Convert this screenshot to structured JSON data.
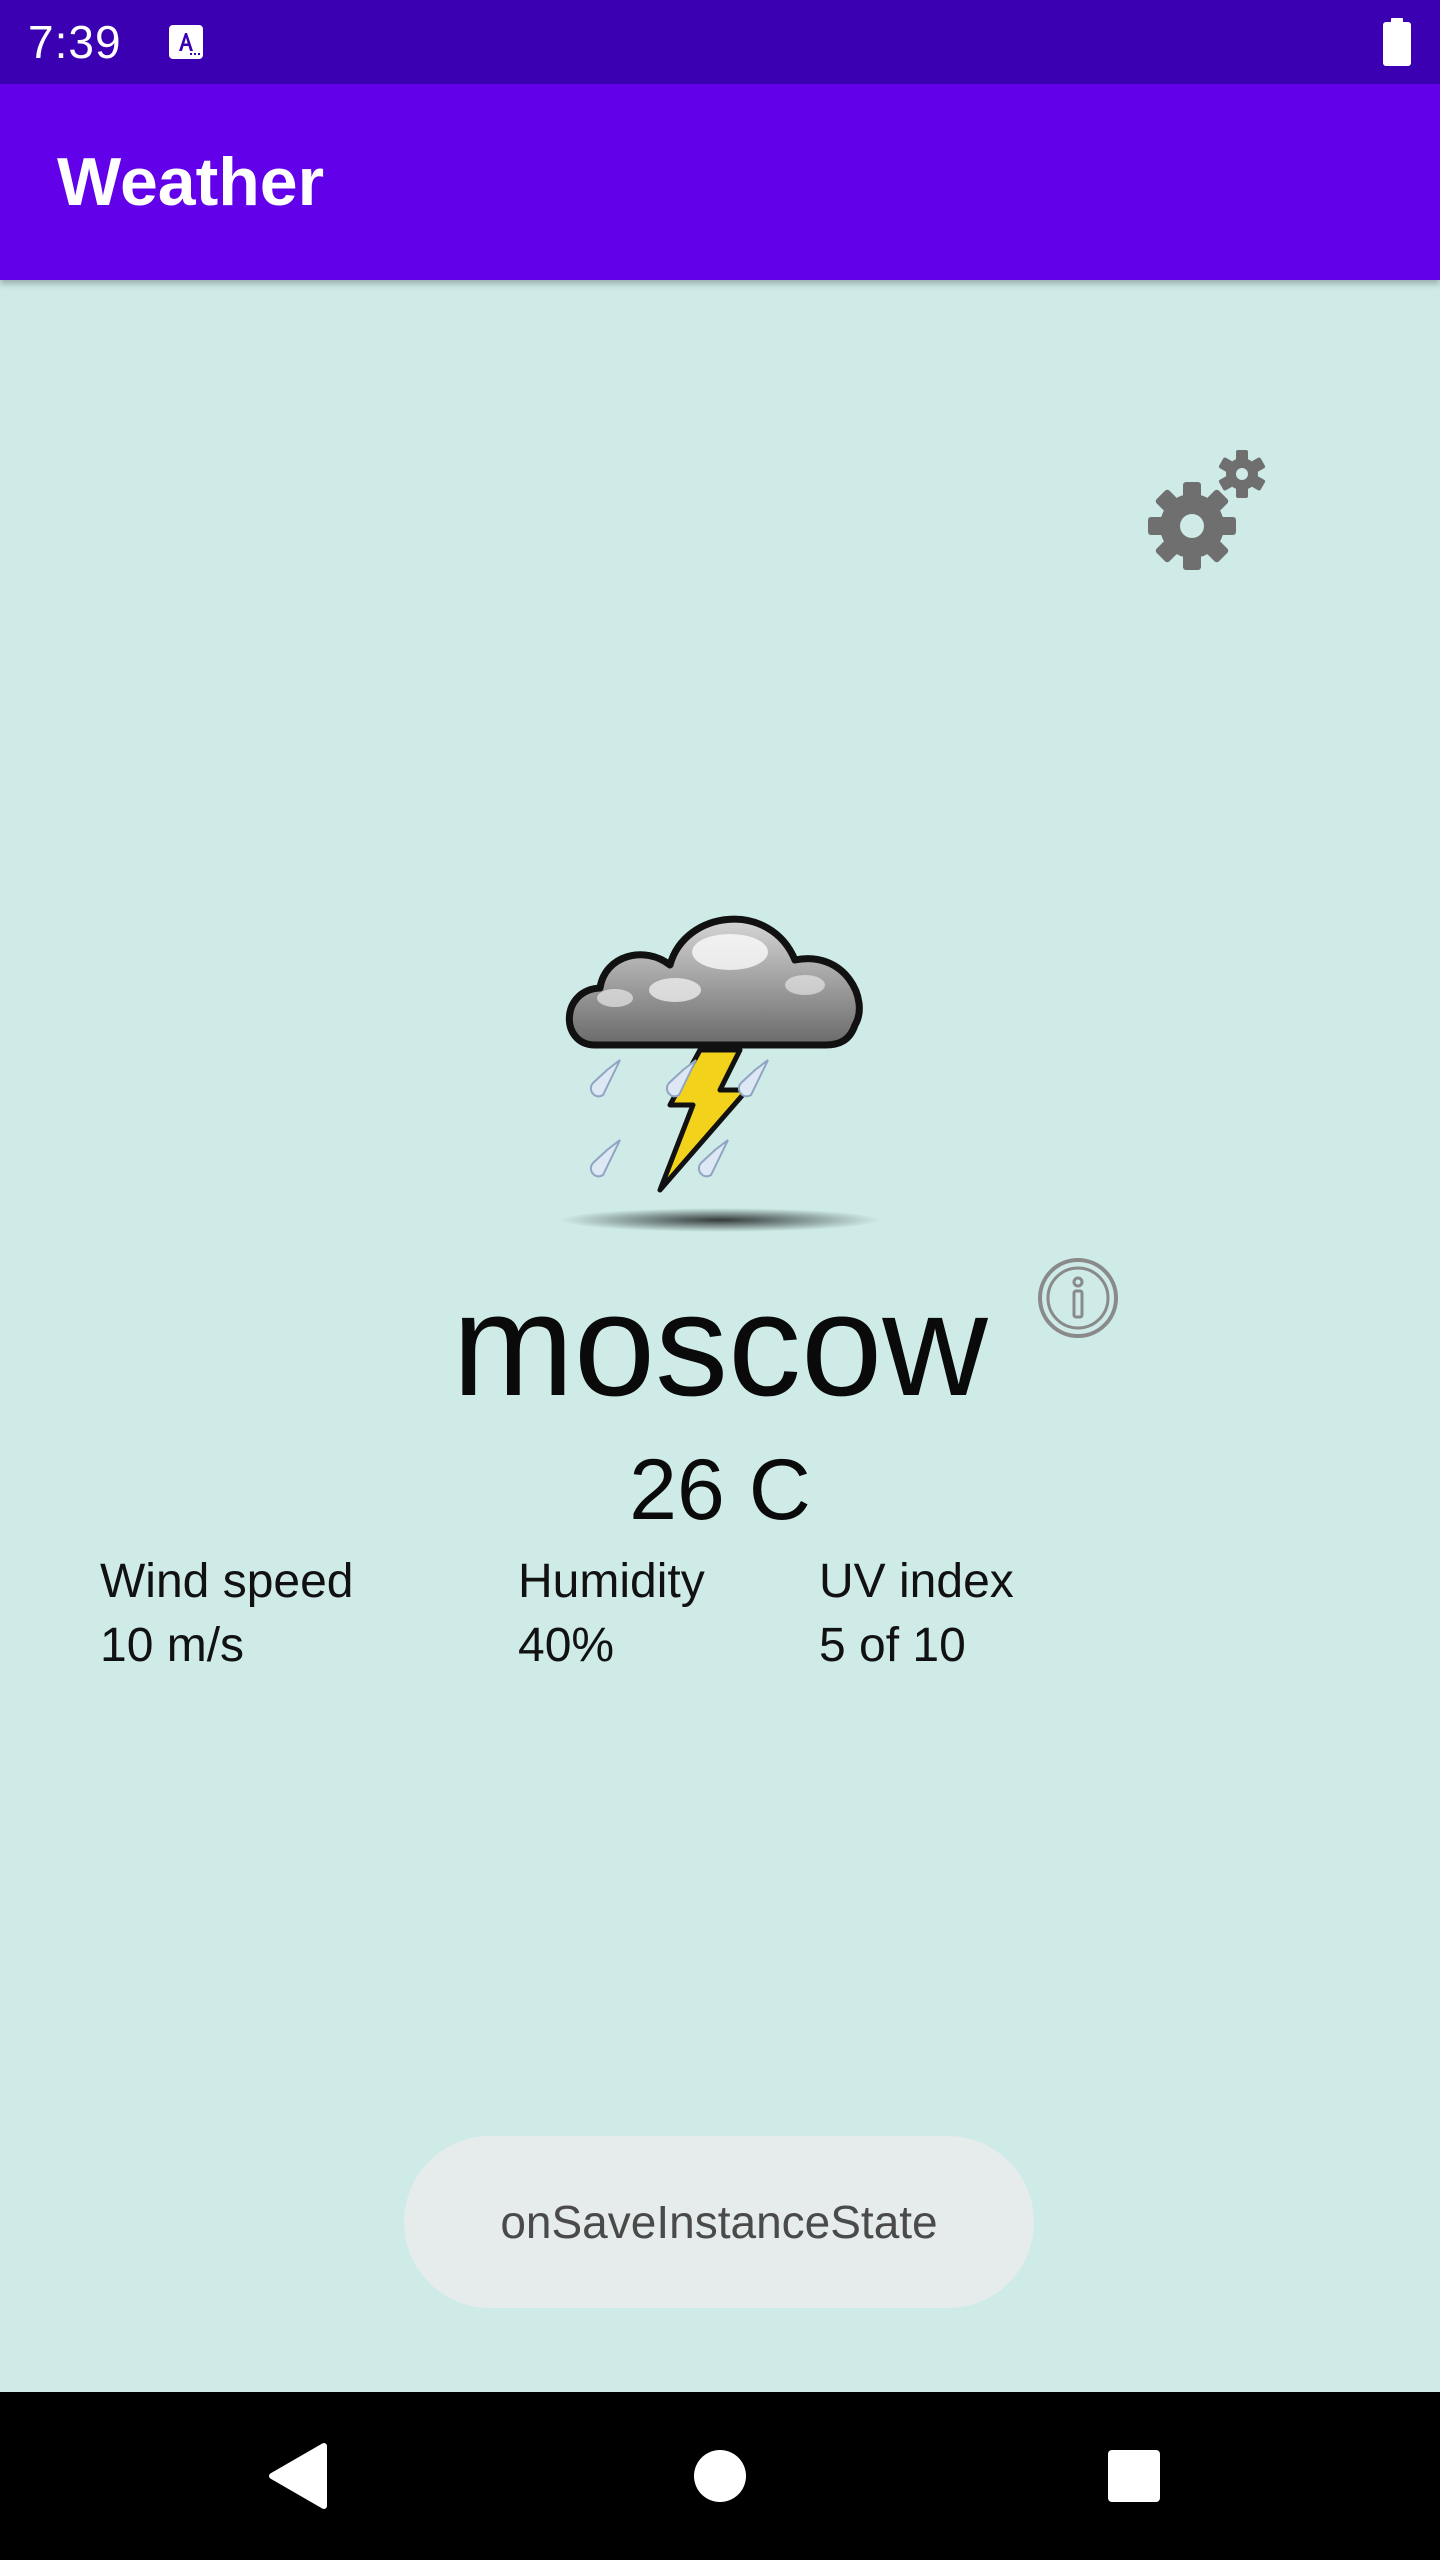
{
  "status_bar": {
    "time": "7:39",
    "notification_icon": "text-a-notification-icon",
    "battery_icon": "battery-full-icon",
    "background": "#3a00b2"
  },
  "app_bar": {
    "title": "Weather",
    "background": "#6200ea"
  },
  "main": {
    "background": "#ceebe8",
    "settings_icon": "gears-icon",
    "weather_icon": "thunderstorm-rain-icon",
    "city": "moscow",
    "info_icon": "info-icon",
    "temperature": "26 C",
    "metrics": {
      "wind": {
        "label": "Wind speed",
        "value": "10 m/s"
      },
      "humidity": {
        "label": "Humidity",
        "value": "40%"
      },
      "uv": {
        "label": "UV index",
        "value": "5 of 10"
      }
    }
  },
  "toast": {
    "message": "onSaveInstanceState"
  },
  "nav_bar": {
    "back_icon": "back-triangle-icon",
    "home_icon": "home-circle-icon",
    "recents_icon": "recents-square-icon"
  }
}
